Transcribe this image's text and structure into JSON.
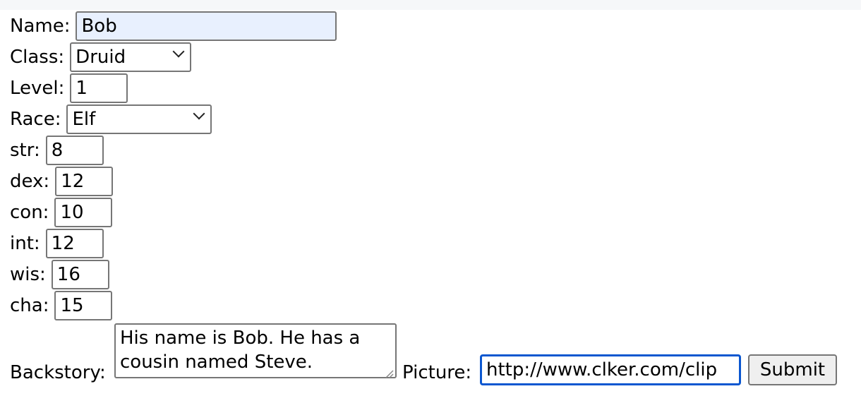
{
  "form": {
    "name": {
      "label": "Name:",
      "value": "Bob"
    },
    "class": {
      "label": "Class:",
      "selected": "Druid"
    },
    "level": {
      "label": "Level:",
      "value": "1"
    },
    "race": {
      "label": "Race:",
      "selected": "Elf"
    },
    "stats": [
      {
        "label": "str:",
        "value": "8"
      },
      {
        "label": "dex:",
        "value": "12"
      },
      {
        "label": "con:",
        "value": "10"
      },
      {
        "label": "int:",
        "value": "12"
      },
      {
        "label": "wis:",
        "value": "16"
      },
      {
        "label": "cha:",
        "value": "15"
      }
    ],
    "backstory": {
      "label": "Backstory:",
      "value": "His name is Bob. He has a cousin named Steve."
    },
    "picture": {
      "label": "Picture:",
      "value": "http://www.clker.com/clip"
    },
    "submit_label": "Submit"
  },
  "colors": {
    "focus_border": "#0b57d0",
    "autofill_bg": "#e8f0fe"
  }
}
